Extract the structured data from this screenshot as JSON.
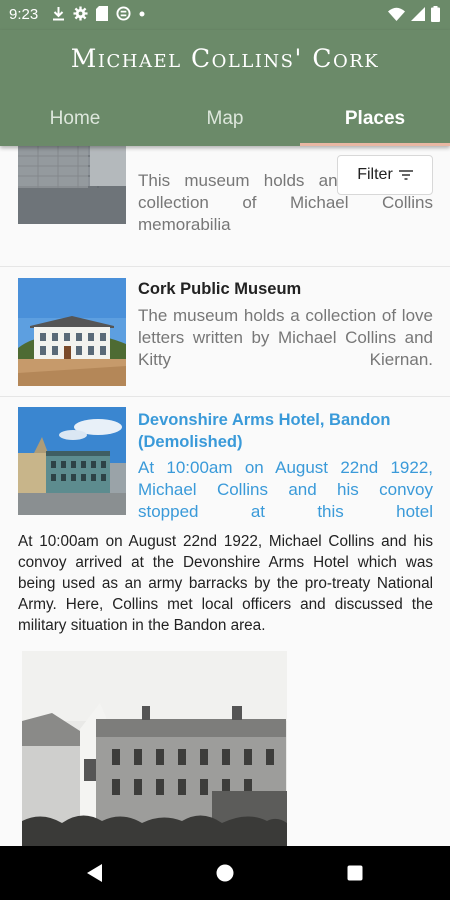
{
  "status_bar": {
    "time": "9:23",
    "left_icons": [
      "download-icon",
      "settings-icon",
      "sd-card-icon",
      "sync-icon",
      "dot-icon"
    ],
    "right_icons": [
      "wifi-icon",
      "signal-icon",
      "battery-icon"
    ]
  },
  "header": {
    "title": "Michael Collins' Cork"
  },
  "tabs": [
    {
      "label": "Home"
    },
    {
      "label": "Map"
    },
    {
      "label": "Places"
    }
  ],
  "filter": {
    "label": "Filter"
  },
  "places": [
    {
      "title": "",
      "description": "This museum holds an impressive collection of Michael Collins memorabilia"
    },
    {
      "title": "Cork Public Museum",
      "description": "The museum holds a collection of love letters written by Michael Collins and Kitty Kiernan."
    },
    {
      "title": "Devonshire Arms Hotel, Bandon (Demolished)",
      "description": "At 10:00am on August 22nd 1922, Michael Collins and his convoy stopped at this hotel",
      "full_text": "At 10:00am on August 22nd 1922, Michael Collins and his convoy arrived at the Devonshire Arms Hotel which was being used as an army barracks by the pro-treaty National Army. Here, Collins met local officers and discussed the military situation in the Bandon area."
    }
  ],
  "colors": {
    "header": "#6b8a69",
    "tab_indicator": "#e8b7a3",
    "link": "#3a9ad9"
  }
}
